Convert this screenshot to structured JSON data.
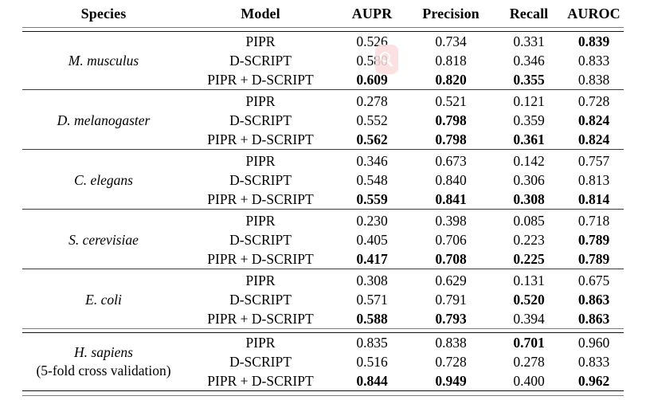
{
  "table": {
    "columns": [
      "Species",
      "Model",
      "AUPR",
      "Precision",
      "Recall",
      "AUROC"
    ],
    "groups": [
      {
        "species": "M. musculus",
        "species_note": "",
        "rows": [
          {
            "model": "PIPR",
            "model_bold": false,
            "aupr": "0.526",
            "aupr_bold": false,
            "precision": "0.734",
            "precision_bold": false,
            "recall": "0.331",
            "recall_bold": false,
            "auroc": "0.839",
            "auroc_bold": true
          },
          {
            "model": "D-SCRIPT",
            "model_bold": false,
            "aupr": "0.580",
            "aupr_bold": false,
            "precision": "0.818",
            "precision_bold": false,
            "recall": "0.346",
            "recall_bold": false,
            "auroc": "0.833",
            "auroc_bold": false
          },
          {
            "model": "PIPR + D-SCRIPT",
            "model_bold": false,
            "aupr": "0.609",
            "aupr_bold": true,
            "precision": "0.820",
            "precision_bold": true,
            "recall": "0.355",
            "recall_bold": true,
            "auroc": "0.838",
            "auroc_bold": false
          }
        ]
      },
      {
        "species": "D. melanogaster",
        "species_note": "",
        "rows": [
          {
            "model": "PIPR",
            "model_bold": false,
            "aupr": "0.278",
            "aupr_bold": false,
            "precision": "0.521",
            "precision_bold": false,
            "recall": "0.121",
            "recall_bold": false,
            "auroc": "0.728",
            "auroc_bold": false
          },
          {
            "model": "D-SCRIPT",
            "model_bold": false,
            "aupr": "0.552",
            "aupr_bold": false,
            "precision": "0.798",
            "precision_bold": true,
            "recall": "0.359",
            "recall_bold": false,
            "auroc": "0.824",
            "auroc_bold": true
          },
          {
            "model": "PIPR + D-SCRIPT",
            "model_bold": false,
            "aupr": "0.562",
            "aupr_bold": true,
            "precision": "0.798",
            "precision_bold": true,
            "recall": "0.361",
            "recall_bold": true,
            "auroc": "0.824",
            "auroc_bold": true
          }
        ]
      },
      {
        "species": "C. elegans",
        "species_note": "",
        "rows": [
          {
            "model": "PIPR",
            "model_bold": false,
            "aupr": "0.346",
            "aupr_bold": false,
            "precision": "0.673",
            "precision_bold": false,
            "recall": "0.142",
            "recall_bold": false,
            "auroc": "0.757",
            "auroc_bold": false
          },
          {
            "model": "D-SCRIPT",
            "model_bold": false,
            "aupr": "0.548",
            "aupr_bold": false,
            "precision": "0.840",
            "precision_bold": false,
            "recall": "0.306",
            "recall_bold": false,
            "auroc": "0.813",
            "auroc_bold": false
          },
          {
            "model": "PIPR + D-SCRIPT",
            "model_bold": false,
            "aupr": "0.559",
            "aupr_bold": true,
            "precision": "0.841",
            "precision_bold": true,
            "recall": "0.308",
            "recall_bold": true,
            "auroc": "0.814",
            "auroc_bold": true
          }
        ]
      },
      {
        "species": "S. cerevisiae",
        "species_note": "",
        "rows": [
          {
            "model": "PIPR",
            "model_bold": false,
            "aupr": "0.230",
            "aupr_bold": false,
            "precision": "0.398",
            "precision_bold": false,
            "recall": "0.085",
            "recall_bold": false,
            "auroc": "0.718",
            "auroc_bold": false
          },
          {
            "model": "D-SCRIPT",
            "model_bold": false,
            "aupr": "0.405",
            "aupr_bold": false,
            "precision": "0.706",
            "precision_bold": false,
            "recall": "0.223",
            "recall_bold": false,
            "auroc": "0.789",
            "auroc_bold": true
          },
          {
            "model": "PIPR + D-SCRIPT",
            "model_bold": false,
            "aupr": "0.417",
            "aupr_bold": true,
            "precision": "0.708",
            "precision_bold": true,
            "recall": "0.225",
            "recall_bold": true,
            "auroc": "0.789",
            "auroc_bold": true
          }
        ]
      },
      {
        "species": "E. coli",
        "species_note": "",
        "rows": [
          {
            "model": "PIPR",
            "model_bold": false,
            "aupr": "0.308",
            "aupr_bold": false,
            "precision": "0.629",
            "precision_bold": false,
            "recall": "0.131",
            "recall_bold": false,
            "auroc": "0.675",
            "auroc_bold": false
          },
          {
            "model": "D-SCRIPT",
            "model_bold": false,
            "aupr": "0.571",
            "aupr_bold": false,
            "precision": "0.791",
            "precision_bold": false,
            "recall": "0.520",
            "recall_bold": true,
            "auroc": "0.863",
            "auroc_bold": true
          },
          {
            "model": "PIPR + D-SCRIPT",
            "model_bold": false,
            "aupr": "0.588",
            "aupr_bold": true,
            "precision": "0.793",
            "precision_bold": true,
            "recall": "0.394",
            "recall_bold": false,
            "auroc": "0.863",
            "auroc_bold": true
          }
        ]
      },
      {
        "species": "H. sapiens",
        "species_note": "(5-fold cross validation)",
        "rows": [
          {
            "model": "PIPR",
            "model_bold": false,
            "aupr": "0.835",
            "aupr_bold": false,
            "precision": "0.838",
            "precision_bold": false,
            "recall": "0.701",
            "recall_bold": true,
            "auroc": "0.960",
            "auroc_bold": false
          },
          {
            "model": "D-SCRIPT",
            "model_bold": false,
            "aupr": "0.516",
            "aupr_bold": false,
            "precision": "0.728",
            "precision_bold": false,
            "recall": "0.278",
            "recall_bold": false,
            "auroc": "0.833",
            "auroc_bold": false
          },
          {
            "model": "PIPR + D-SCRIPT",
            "model_bold": false,
            "aupr": "0.844",
            "aupr_bold": true,
            "precision": "0.949",
            "precision_bold": true,
            "recall": "0.400",
            "recall_bold": false,
            "auroc": "0.962",
            "auroc_bold": true
          }
        ]
      }
    ]
  },
  "overlay": {
    "cursor_icon": "zoom-magnifier-icon",
    "highlight_color": "#fbdcdc"
  }
}
